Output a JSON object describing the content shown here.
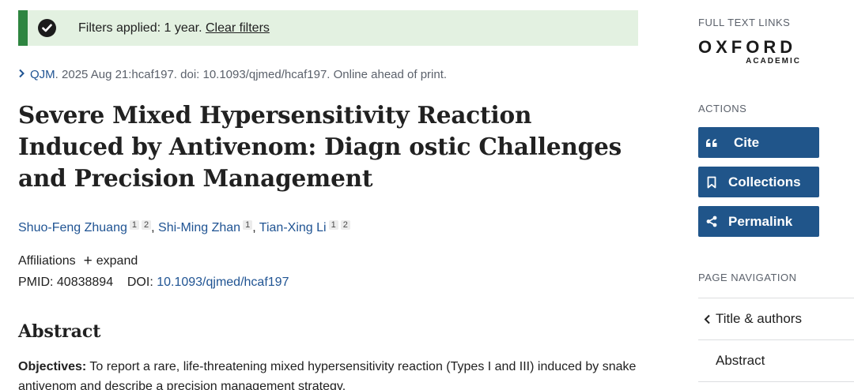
{
  "banner": {
    "text": "Filters applied: 1 year.",
    "clear_label": "Clear filters"
  },
  "citation": {
    "journal": "QJM",
    "rest": ". 2025 Aug 21:hcaf197. doi: 10.1093/qjmed/hcaf197. Online ahead of print."
  },
  "article": {
    "title": "Severe Mixed Hypersensitivity Reaction Induced by Antivenom: Diagn ostic Challenges and Precision Management",
    "authors": [
      {
        "name": "Shuo-Feng Zhuang",
        "affils": [
          "1",
          "2"
        ]
      },
      {
        "name": "Shi-Ming Zhan",
        "affils": [
          "1"
        ]
      },
      {
        "name": "Tian-Xing Li",
        "affils": [
          "1",
          "2"
        ]
      }
    ],
    "affiliations_label": "Affiliations",
    "expand_label": "expand",
    "pmid_label": "PMID:",
    "pmid": "40838894",
    "doi_label": "DOI:",
    "doi": "10.1093/qjmed/hcaf197"
  },
  "abstract": {
    "heading": "Abstract",
    "objectives_label": "Objectives:",
    "objectives_text": "To report a rare, life-threatening mixed hypersensitivity reaction (Types I and III) induced by snake antivenom and describe a precision management strategy."
  },
  "sidebar": {
    "full_text_label": "FULL TEXT LINKS",
    "publisher_logo": {
      "line1": "OXFORD",
      "line2": "ACADEMIC"
    },
    "actions_label": "ACTIONS",
    "buttons": [
      {
        "icon": "quote-icon",
        "label": "Cite"
      },
      {
        "icon": "bookmark-icon",
        "label": "Collections"
      },
      {
        "icon": "share-icon",
        "label": "Permalink"
      }
    ],
    "page_nav_label": "PAGE NAVIGATION",
    "nav_items": [
      {
        "label": "Title & authors",
        "icon": "chevron-left-icon"
      },
      {
        "label": "Abstract"
      }
    ]
  },
  "colors": {
    "link": "#205493",
    "banner_bg": "#e3f1e1",
    "banner_accent": "#2e8540",
    "button_bg": "#20558a"
  }
}
